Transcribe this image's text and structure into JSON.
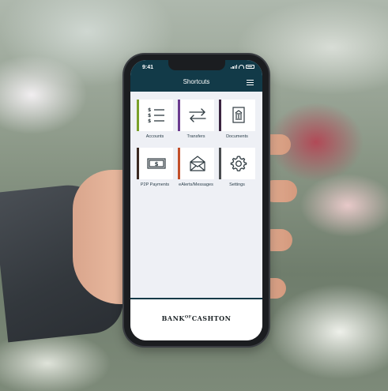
{
  "status": {
    "time": "9:41"
  },
  "header": {
    "title": "Shortcuts"
  },
  "tiles": [
    {
      "label": "Accounts",
      "icon": "accounts-list-icon",
      "accent": "#7aa02a"
    },
    {
      "label": "Transfers",
      "icon": "transfer-arrows-icon",
      "accent": "#6b3b8f"
    },
    {
      "label": "Documents",
      "icon": "document-bank-icon",
      "accent": "#3b2440"
    },
    {
      "label": "P2P Payments",
      "icon": "cash-icon",
      "accent": "#3b2a22"
    },
    {
      "label": "eAlerts/Messages",
      "icon": "envelope-icon",
      "accent": "#c3502a"
    },
    {
      "label": "Settings",
      "icon": "gear-icon",
      "accent": "#4a4d50"
    }
  ],
  "footer": {
    "logo_left": "BANK",
    "logo_of": "OF",
    "logo_right": "CASHTON"
  },
  "colors": {
    "header_bg": "#123a48",
    "screen_bg": "#eef0f5"
  }
}
